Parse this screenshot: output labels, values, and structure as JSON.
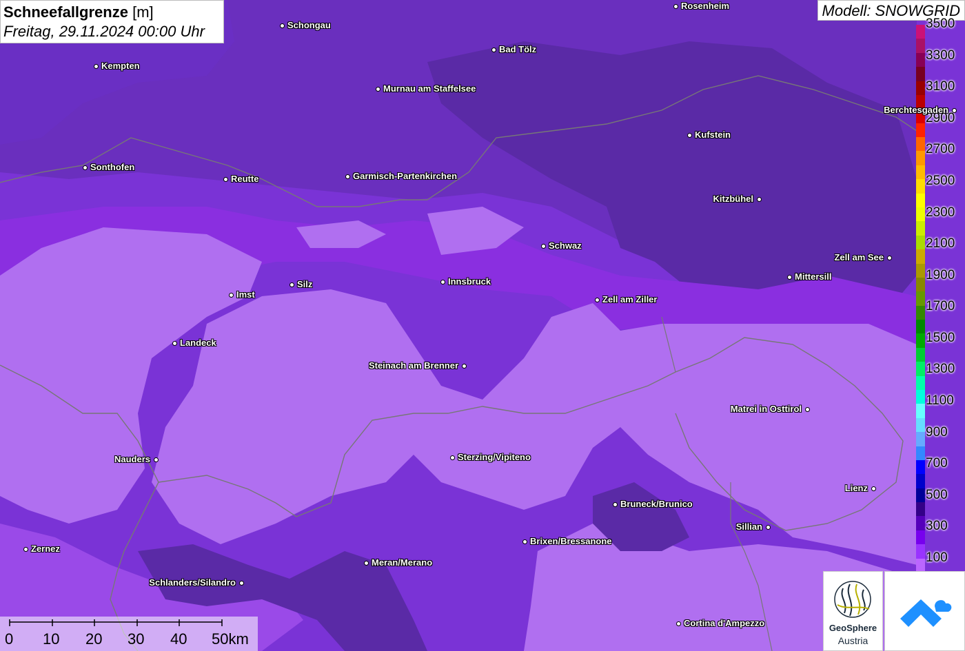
{
  "title": {
    "parameter": "Schneefallgrenze",
    "unit": "[m]",
    "datetime": "Freitag, 29.11.2024 00:00 Uhr"
  },
  "model": "Modell: SNOWGRID",
  "legend": {
    "labels": [
      "3500",
      "3300",
      "3100",
      "2900",
      "2700",
      "2500",
      "2300",
      "2100",
      "1900",
      "1700",
      "1500",
      "1300",
      "1100",
      "900",
      "700",
      "500",
      "300",
      "100"
    ],
    "colors": [
      "#cc1177",
      "#aa1166",
      "#880055",
      "#770022",
      "#990000",
      "#bb0000",
      "#dd0000",
      "#ff2200",
      "#ff6600",
      "#ff9900",
      "#ffbb00",
      "#ffdd00",
      "#ffff00",
      "#eeff00",
      "#ccee00",
      "#aadd00",
      "#ccaa00",
      "#aa9900",
      "#888800",
      "#669900",
      "#338800",
      "#008800",
      "#00aa00",
      "#00cc33",
      "#00ee66",
      "#00ffaa",
      "#00ffdd",
      "#66ffff",
      "#66ddff",
      "#66aaff",
      "#3388ff",
      "#0000ff",
      "#0000cc",
      "#000099",
      "#330088",
      "#5500bb",
      "#7700ee",
      "#9933ff",
      "#bb66ff"
    ]
  },
  "cities": [
    {
      "name": "Rosenheim"
    },
    {
      "name": "Schongau"
    },
    {
      "name": "Bad Tölz"
    },
    {
      "name": "Kempten"
    },
    {
      "name": "Murnau am Staffelsee"
    },
    {
      "name": "Berchtesgaden"
    },
    {
      "name": "Kufstein"
    },
    {
      "name": "Sonthofen"
    },
    {
      "name": "Reutte"
    },
    {
      "name": "Garmisch-Partenkirchen"
    },
    {
      "name": "Kitzbühel"
    },
    {
      "name": "Schwaz"
    },
    {
      "name": "Zell am See"
    },
    {
      "name": "Mittersill"
    },
    {
      "name": "Innsbruck"
    },
    {
      "name": "Imst"
    },
    {
      "name": "Silz"
    },
    {
      "name": "Zell am Ziller"
    },
    {
      "name": "Landeck"
    },
    {
      "name": "Steinach am Brenner"
    },
    {
      "name": "Matrei in Osttirol"
    },
    {
      "name": "Nauders"
    },
    {
      "name": "Sterzing/Vipiteno"
    },
    {
      "name": "Lienz"
    },
    {
      "name": "Bruneck/Brunico"
    },
    {
      "name": "Sillian"
    },
    {
      "name": "Brixen/Bressanone"
    },
    {
      "name": "Zernez"
    },
    {
      "name": "Meran/Merano"
    },
    {
      "name": "Schlanders/Silandro"
    },
    {
      "name": "Cortina d'Ampezzo"
    }
  ],
  "scalebar": {
    "ticks": [
      "0",
      "10",
      "20",
      "30",
      "40",
      "50km"
    ]
  },
  "logos": {
    "geosphere_name": "GeoSphere",
    "geosphere_sub": "Austria"
  }
}
